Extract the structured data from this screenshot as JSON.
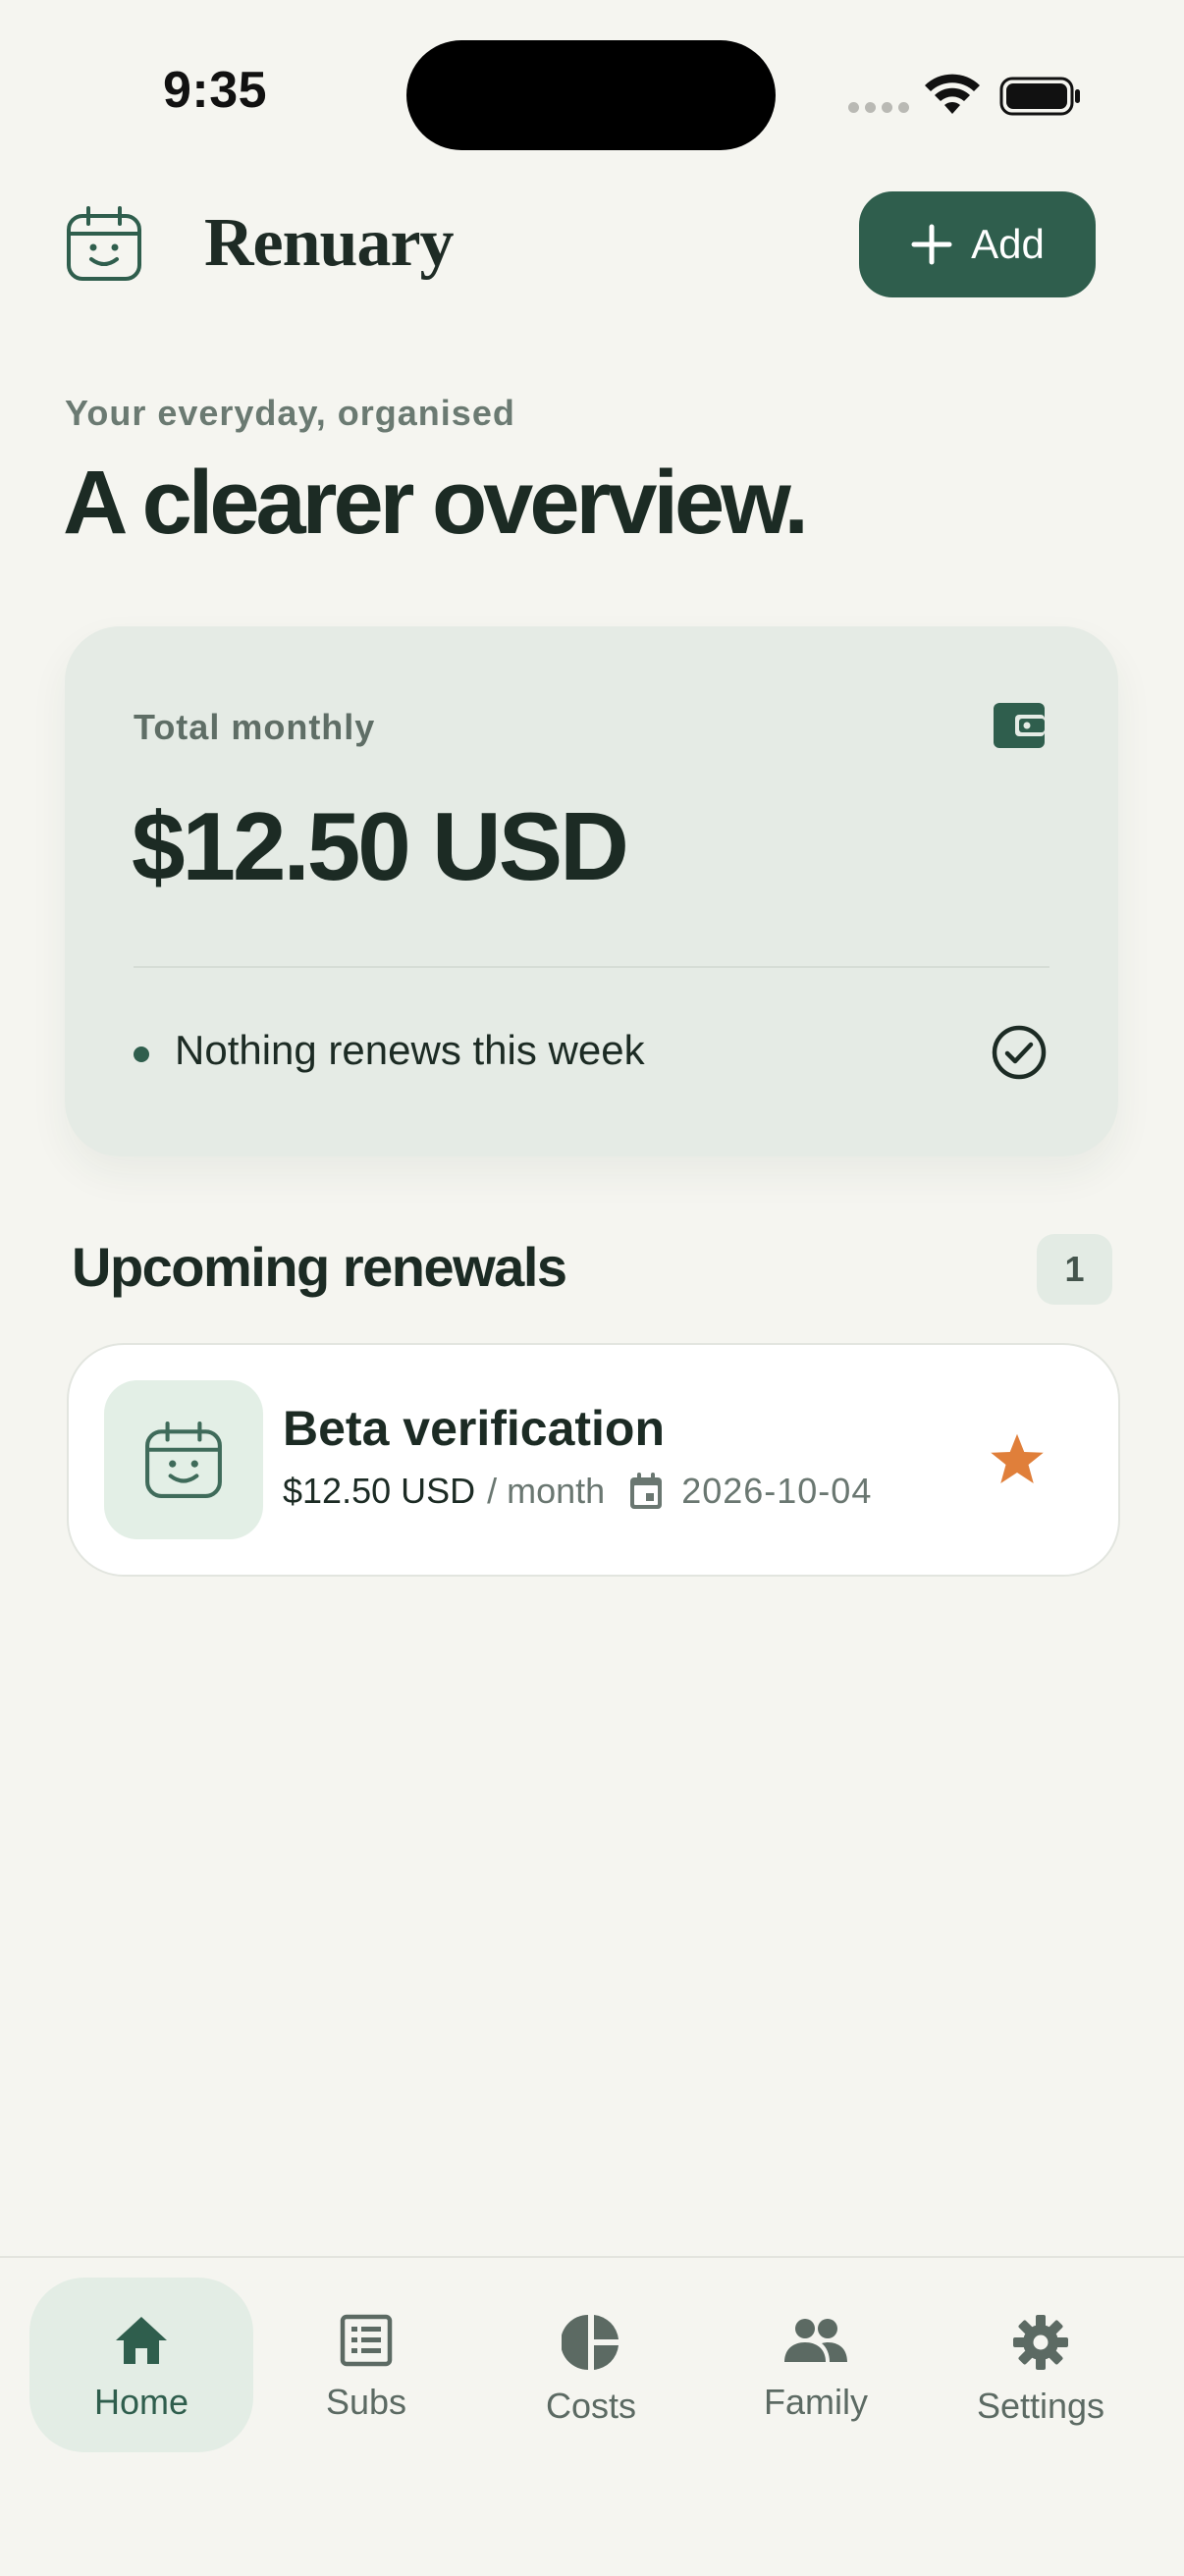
{
  "status_bar": {
    "time": "9:35"
  },
  "header": {
    "app_title": "Renuary",
    "add_label": "Add"
  },
  "intro": {
    "subtitle": "Your everyday, organised",
    "headline": "A clearer overview."
  },
  "summary": {
    "label": "Total monthly",
    "amount": "$12.50 USD",
    "status": "Nothing renews this week"
  },
  "upcoming": {
    "title": "Upcoming renewals",
    "count": "1",
    "items": [
      {
        "name": "Beta verification",
        "price": "$12.50 USD",
        "period": "/ month",
        "date": "2026-10-04",
        "favorite": true
      }
    ]
  },
  "tabs": [
    {
      "label": "Home",
      "icon": "home-icon",
      "active": true
    },
    {
      "label": "Subs",
      "icon": "list-icon",
      "active": false
    },
    {
      "label": "Costs",
      "icon": "pie-chart-icon",
      "active": false
    },
    {
      "label": "Family",
      "icon": "people-icon",
      "active": false
    },
    {
      "label": "Settings",
      "icon": "gear-icon",
      "active": false
    }
  ],
  "colors": {
    "background": "#f5f5f0",
    "primary": "#2f5e4d",
    "card": "#e5ebe5",
    "accent_star": "#e07f3a",
    "text": "#1c2b24",
    "muted": "#6b7a72"
  }
}
